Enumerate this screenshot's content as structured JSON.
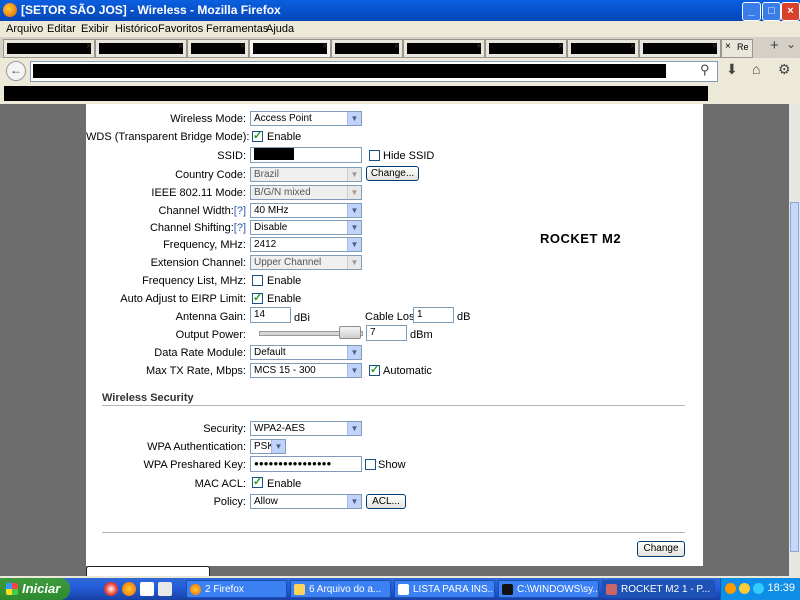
{
  "window": {
    "title": "[SETOR SÃO JOS] - Wireless - Mozilla Firefox",
    "min": "_",
    "max": "□",
    "close": "×"
  },
  "menu": [
    "Arquivo",
    "Editar",
    "Exibir",
    "Histórico",
    "Favoritos",
    "Ferramentas",
    "Ajuda"
  ],
  "tabs": {
    "overflow_label": "Re",
    "new_tab": "+",
    "list": "⌄"
  },
  "nav": {
    "back": "←",
    "search_glyph": "⚲"
  },
  "form": {
    "wireless_mode": {
      "label": "Wireless Mode:",
      "value": "Access Point"
    },
    "wds": {
      "label": "WDS (Transparent Bridge Mode):",
      "text": "Enable",
      "checked": true
    },
    "ssid": {
      "label": "SSID:",
      "hide_text": "Hide SSID"
    },
    "country": {
      "label": "Country Code:",
      "value": "Brazil",
      "button": "Change..."
    },
    "ieee": {
      "label": "IEEE 802.11 Mode:",
      "value": "B/G/N mixed"
    },
    "channel_width": {
      "label": "Channel Width:",
      "help": "[?]",
      "value": "40 MHz"
    },
    "channel_shifting": {
      "label": "Channel Shifting:",
      "help": "[?]",
      "value": "Disable"
    },
    "frequency": {
      "label": "Frequency, MHz:",
      "value": "2412"
    },
    "extension": {
      "label": "Extension Channel:",
      "value": "Upper Channel"
    },
    "freq_list": {
      "label": "Frequency List, MHz:",
      "text": "Enable",
      "checked": false
    },
    "eirp": {
      "label": "Auto Adjust to EIRP Limit:",
      "text": "Enable",
      "checked": true
    },
    "antenna_gain": {
      "label": "Antenna Gain:",
      "value": "14",
      "unit": "dBi"
    },
    "cable_loss": {
      "label": "Cable Loss:",
      "value": "1",
      "unit": "dB"
    },
    "output_power": {
      "label": "Output Power:",
      "value": "7",
      "unit": "dBm"
    },
    "data_rate": {
      "label": "Data Rate Module:",
      "value": "Default"
    },
    "max_tx": {
      "label": "Max TX Rate, Mbps:",
      "value": "MCS 15 - 300",
      "auto_text": "Automatic",
      "auto_checked": true
    }
  },
  "annotation": "ROCKET M2",
  "security": {
    "heading": "Wireless Security",
    "security": {
      "label": "Security:",
      "value": "WPA2-AES"
    },
    "wpa_auth": {
      "label": "WPA Authentication:",
      "value": "PSK"
    },
    "psk": {
      "label": "WPA Preshared Key:",
      "value": "●●●●●●●●●●●●●●●●",
      "show_text": "Show"
    },
    "mac_acl": {
      "label": "MAC ACL:",
      "text": "Enable",
      "checked": true
    },
    "policy": {
      "label": "Policy:",
      "value": "Allow",
      "button": "ACL..."
    }
  },
  "change_button": "Change",
  "taskbar": {
    "start": "Iniciar",
    "tasks": [
      "2 Firefox",
      "6 Arquivo do a...",
      "LISTA PARA INS...",
      "C:\\WINDOWS\\sy...",
      "ROCKET M2 1 - P..."
    ],
    "clock": "18:39"
  }
}
